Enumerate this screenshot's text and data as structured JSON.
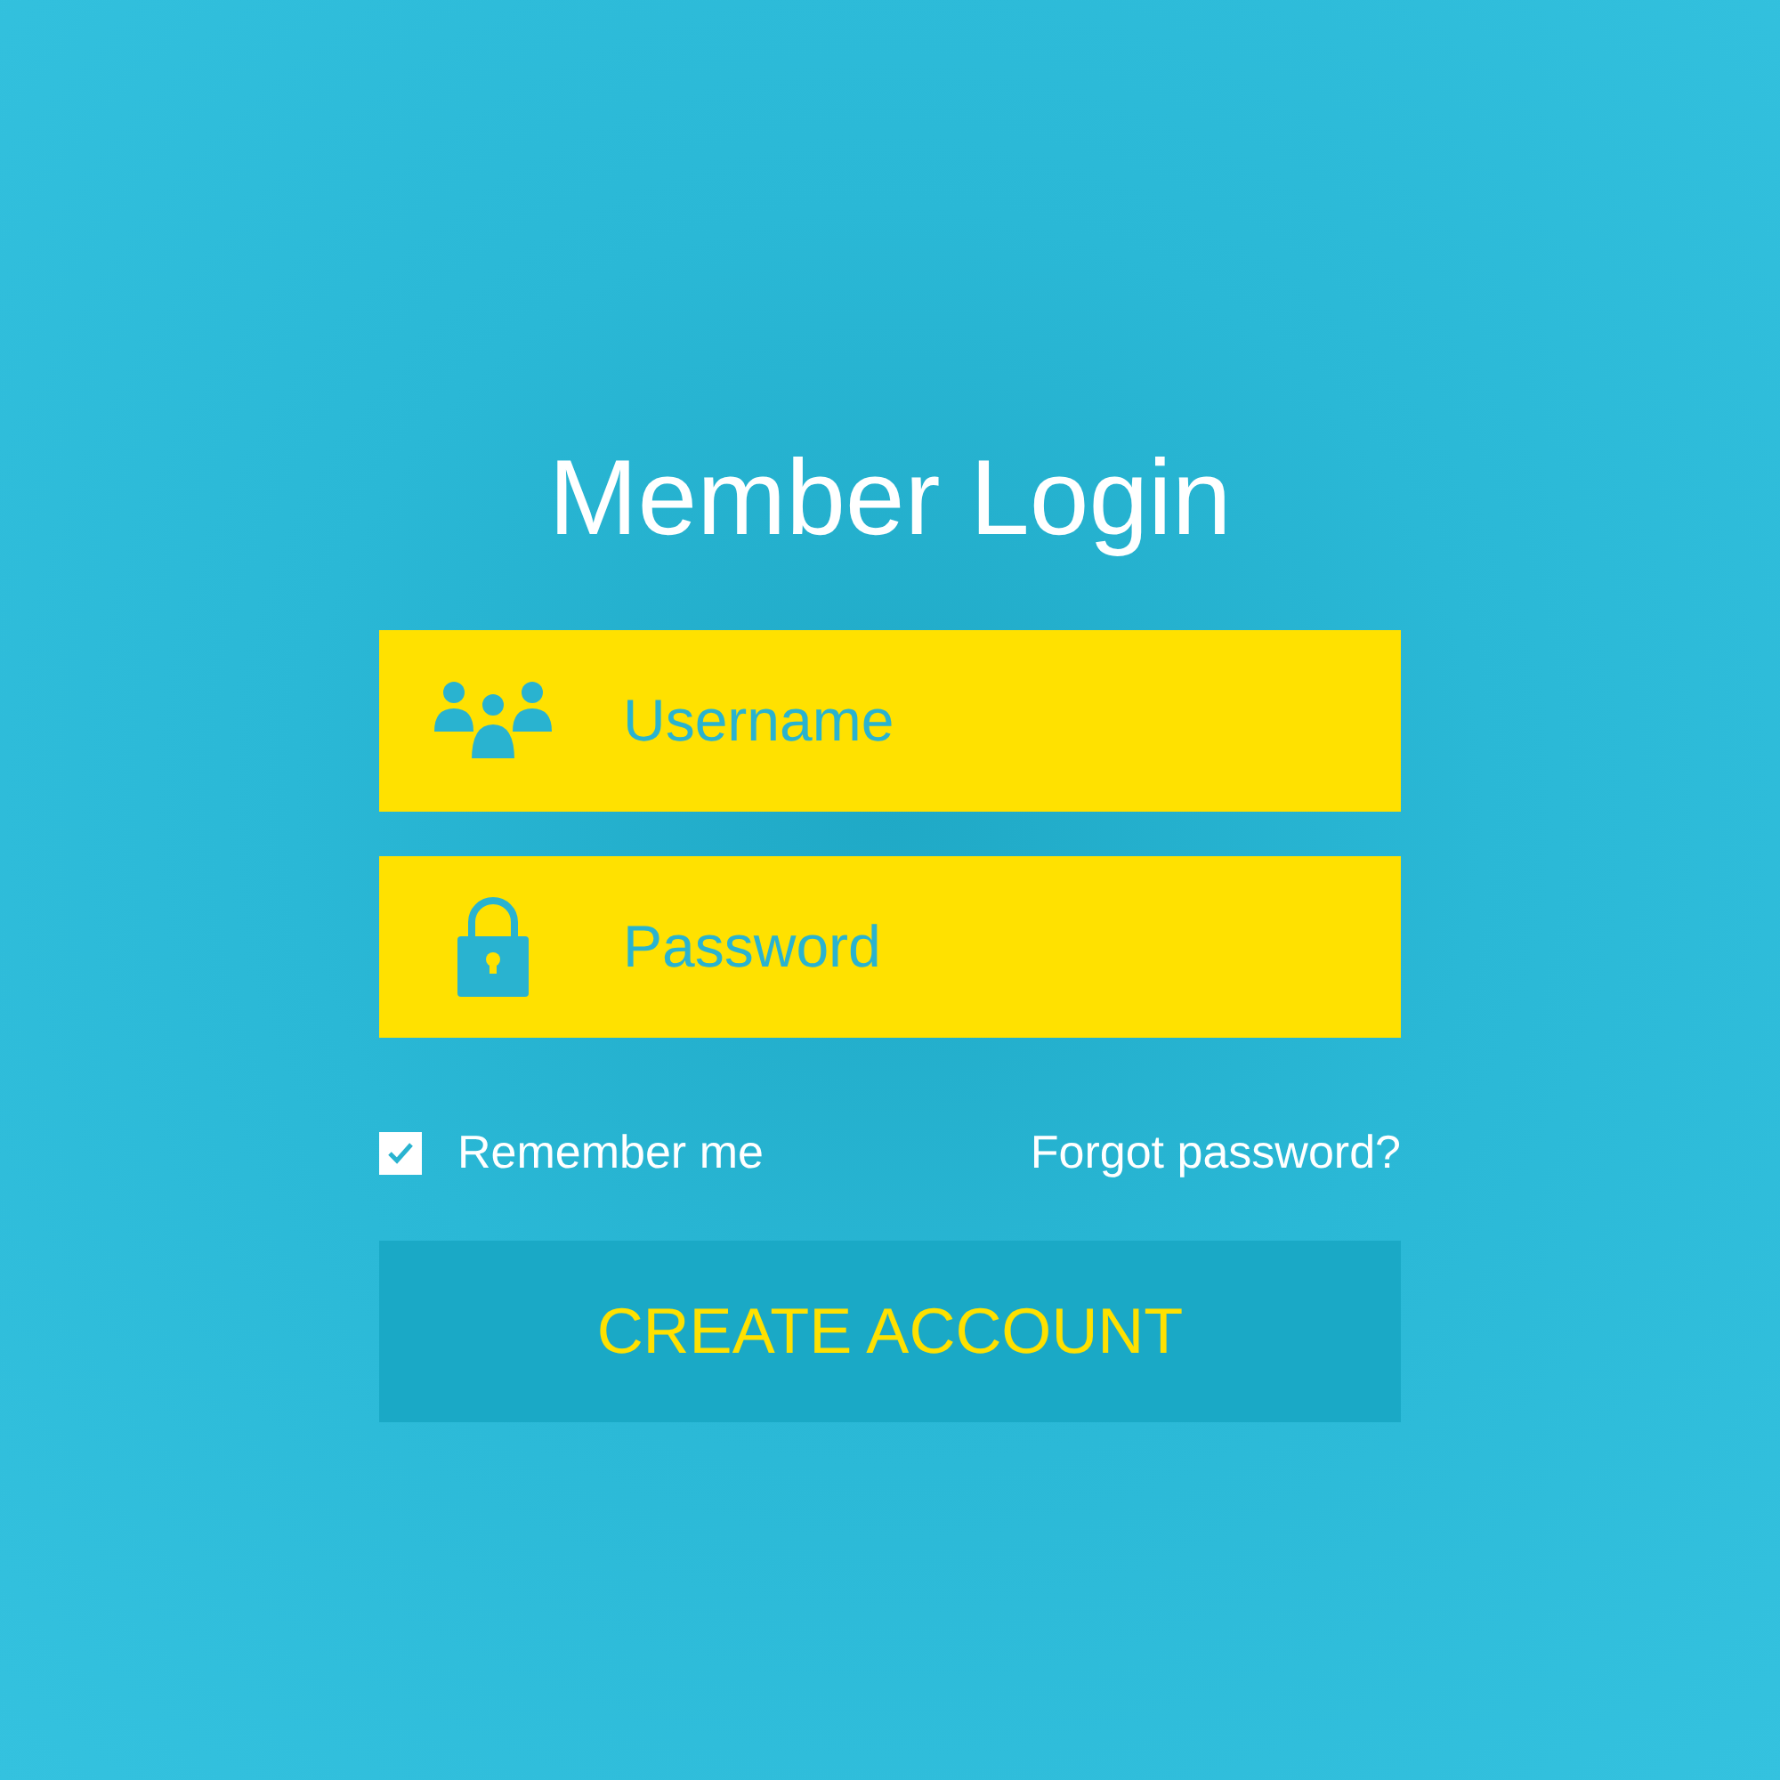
{
  "title": "Member Login",
  "fields": [
    {
      "kind": "user",
      "placeholder": "Username"
    },
    {
      "kind": "password",
      "placeholder": "Password"
    }
  ],
  "remember": {
    "label": "Remember me",
    "checked": true
  },
  "forgot_link": "Forgot password?",
  "button": "CREATE ACCOUNT"
}
